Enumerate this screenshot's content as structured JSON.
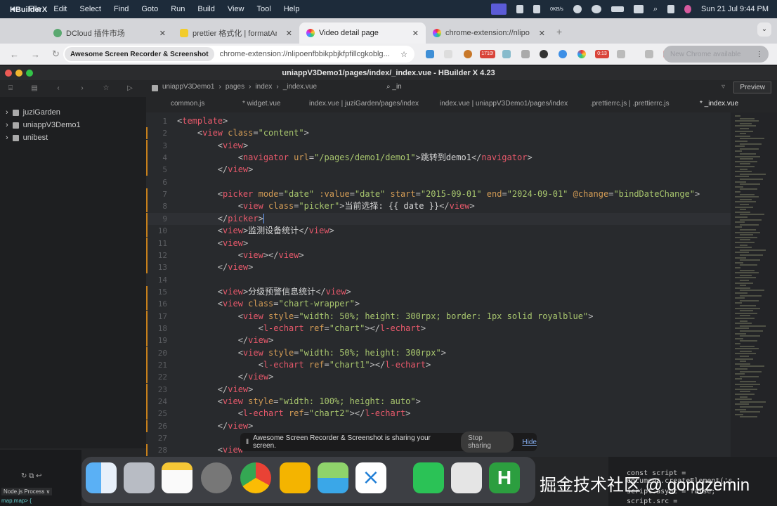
{
  "menubar": {
    "app": "HBuilderX",
    "items": [
      "File",
      "Edit",
      "Select",
      "Find",
      "Goto",
      "Run",
      "Build",
      "View",
      "Tool",
      "Help"
    ],
    "net": "0KB/s",
    "clock": "Sun 21 Jul  9:44 PM"
  },
  "browser": {
    "tabs": [
      {
        "label": "DCloud 插件市场"
      },
      {
        "label": "prettier 格式化 | formatAndS..."
      },
      {
        "label": "Video detail page"
      },
      {
        "label": "chrome-extension://nlipoenf..."
      }
    ],
    "chip": "Awesome Screen Recorder & Screenshot",
    "url": "chrome-extension://nlipoenfbbikpbjkfpfillcgkoblg...",
    "badge1": "1710!",
    "badge2": "0:13",
    "new_chrome": "New Chrome available"
  },
  "ide": {
    "title": "uniappV3Demo1/pages/index/_index.vue - HBuilder X 4.23",
    "breadcrumb": [
      "uniappV3Demo1",
      "pages",
      "index",
      "_index.vue"
    ],
    "search": "_in",
    "preview": "Preview",
    "tabs": [
      "common.js",
      "* widget.vue",
      "index.vue | juziGarden/pages/index",
      "index.vue | uniappV3Demo1/pages/index",
      ".prettierrc.js | .prettierrc.js",
      "* _index.vue"
    ],
    "projects": [
      "juziGarden",
      "uniappV3Demo1",
      "unibest"
    ],
    "lines": [
      [
        [
          "punct",
          "<"
        ],
        [
          "tag",
          "template"
        ],
        [
          "punct",
          ">"
        ]
      ],
      [
        [
          "punct",
          "    <"
        ],
        [
          "tag",
          "view "
        ],
        [
          "attr",
          "class"
        ],
        [
          "punct",
          "="
        ],
        [
          "str",
          "\"content\""
        ],
        [
          "punct",
          ">"
        ]
      ],
      [
        [
          "punct",
          "        <"
        ],
        [
          "tag",
          "view"
        ],
        [
          "punct",
          ">"
        ]
      ],
      [
        [
          "punct",
          "            <"
        ],
        [
          "tag",
          "navigator "
        ],
        [
          "attr",
          "url"
        ],
        [
          "punct",
          "="
        ],
        [
          "str",
          "\"/pages/demo1/demo1\""
        ],
        [
          "punct",
          ">"
        ],
        [
          "text",
          "跳转到demo1"
        ],
        [
          "punct",
          "</"
        ],
        [
          "tag",
          "navigator"
        ],
        [
          "punct",
          ">"
        ]
      ],
      [
        [
          "punct",
          "        </"
        ],
        [
          "tag",
          "view"
        ],
        [
          "punct",
          ">"
        ]
      ],
      [],
      [
        [
          "punct",
          "        <"
        ],
        [
          "tag",
          "picker "
        ],
        [
          "attr",
          "mode"
        ],
        [
          "punct",
          "="
        ],
        [
          "str",
          "\"date\" "
        ],
        [
          "attr",
          ":value"
        ],
        [
          "punct",
          "="
        ],
        [
          "str",
          "\"date\" "
        ],
        [
          "attr",
          "start"
        ],
        [
          "punct",
          "="
        ],
        [
          "str",
          "\"2015-09-01\" "
        ],
        [
          "attr",
          "end"
        ],
        [
          "punct",
          "="
        ],
        [
          "str",
          "\"2024-09-01\" "
        ],
        [
          "attr",
          "@change"
        ],
        [
          "punct",
          "="
        ],
        [
          "str",
          "\"bindDateChange\""
        ],
        [
          "punct",
          ">"
        ]
      ],
      [
        [
          "punct",
          "            <"
        ],
        [
          "tag",
          "view "
        ],
        [
          "attr",
          "class"
        ],
        [
          "punct",
          "="
        ],
        [
          "str",
          "\"picker\""
        ],
        [
          "punct",
          ">"
        ],
        [
          "text",
          "当前选择: {{ date }}"
        ],
        [
          "punct",
          "</"
        ],
        [
          "tag",
          "view"
        ],
        [
          "punct",
          ">"
        ]
      ],
      [
        [
          "punct",
          "        </"
        ],
        [
          "tag",
          "picker"
        ],
        [
          "punct",
          ">"
        ]
      ],
      [
        [
          "punct",
          "        <"
        ],
        [
          "tag",
          "view"
        ],
        [
          "punct",
          ">"
        ],
        [
          "text",
          "监测设备统计"
        ],
        [
          "punct",
          "</"
        ],
        [
          "tag",
          "view"
        ],
        [
          "punct",
          ">"
        ]
      ],
      [
        [
          "punct",
          "        <"
        ],
        [
          "tag",
          "view"
        ],
        [
          "punct",
          ">"
        ]
      ],
      [
        [
          "punct",
          "            <"
        ],
        [
          "tag",
          "view"
        ],
        [
          "punct",
          "></"
        ],
        [
          "tag",
          "view"
        ],
        [
          "punct",
          ">"
        ]
      ],
      [
        [
          "punct",
          "        </"
        ],
        [
          "tag",
          "view"
        ],
        [
          "punct",
          ">"
        ]
      ],
      [],
      [
        [
          "punct",
          "        <"
        ],
        [
          "tag",
          "view"
        ],
        [
          "punct",
          ">"
        ],
        [
          "text",
          "分级预警信息统计"
        ],
        [
          "punct",
          "</"
        ],
        [
          "tag",
          "view"
        ],
        [
          "punct",
          ">"
        ]
      ],
      [
        [
          "punct",
          "        <"
        ],
        [
          "tag",
          "view "
        ],
        [
          "attr",
          "class"
        ],
        [
          "punct",
          "="
        ],
        [
          "str",
          "\"chart-wrapper\""
        ],
        [
          "punct",
          ">"
        ]
      ],
      [
        [
          "punct",
          "            <"
        ],
        [
          "tag",
          "view "
        ],
        [
          "attr",
          "style"
        ],
        [
          "punct",
          "="
        ],
        [
          "str",
          "\"width: 50%; height: 300rpx; border: 1px solid royalblue\""
        ],
        [
          "punct",
          ">"
        ]
      ],
      [
        [
          "punct",
          "                <"
        ],
        [
          "tag",
          "l-echart "
        ],
        [
          "attr",
          "ref"
        ],
        [
          "punct",
          "="
        ],
        [
          "str",
          "\"chart\""
        ],
        [
          "punct",
          "></"
        ],
        [
          "tag",
          "l-echart"
        ],
        [
          "punct",
          ">"
        ]
      ],
      [
        [
          "punct",
          "            </"
        ],
        [
          "tag",
          "view"
        ],
        [
          "punct",
          ">"
        ]
      ],
      [
        [
          "punct",
          "            <"
        ],
        [
          "tag",
          "view "
        ],
        [
          "attr",
          "style"
        ],
        [
          "punct",
          "="
        ],
        [
          "str",
          "\"width: 50%; height: 300rpx\""
        ],
        [
          "punct",
          ">"
        ]
      ],
      [
        [
          "punct",
          "                <"
        ],
        [
          "tag",
          "l-echart "
        ],
        [
          "attr",
          "ref"
        ],
        [
          "punct",
          "="
        ],
        [
          "str",
          "\"chart1\""
        ],
        [
          "punct",
          "></"
        ],
        [
          "tag",
          "l-echart"
        ],
        [
          "punct",
          ">"
        ]
      ],
      [
        [
          "punct",
          "            </"
        ],
        [
          "tag",
          "view"
        ],
        [
          "punct",
          ">"
        ]
      ],
      [
        [
          "punct",
          "        </"
        ],
        [
          "tag",
          "view"
        ],
        [
          "punct",
          ">"
        ]
      ],
      [
        [
          "punct",
          "        <"
        ],
        [
          "tag",
          "view "
        ],
        [
          "attr",
          "style"
        ],
        [
          "punct",
          "="
        ],
        [
          "str",
          "\"width: 100%; height: auto\""
        ],
        [
          "punct",
          ">"
        ]
      ],
      [
        [
          "punct",
          "            <"
        ],
        [
          "tag",
          "l-echart "
        ],
        [
          "attr",
          "ref"
        ],
        [
          "punct",
          "="
        ],
        [
          "str",
          "\"chart2\""
        ],
        [
          "punct",
          "></"
        ],
        [
          "tag",
          "l-echart"
        ],
        [
          "punct",
          ">"
        ]
      ],
      [
        [
          "punct",
          "        </"
        ],
        [
          "tag",
          "view"
        ],
        [
          "punct",
          ">"
        ]
      ],
      [],
      [
        [
          "punct",
          "        <"
        ],
        [
          "tag",
          "view"
        ]
      ]
    ]
  },
  "share_bar": {
    "text": "Awesome Screen Recorder & Screenshot is sharing your screen.",
    "stop": "Stop sharing",
    "hide": "Hide"
  },
  "terminal": {
    "process": "Node.js Process ∨",
    "prompt": "map.map> {"
  },
  "snippet": [
    "const script = document.createElement('s",
    "script.async = false;",
    "script.src ="
  ],
  "watermark": "掘金技术社区 @ gongzemin"
}
